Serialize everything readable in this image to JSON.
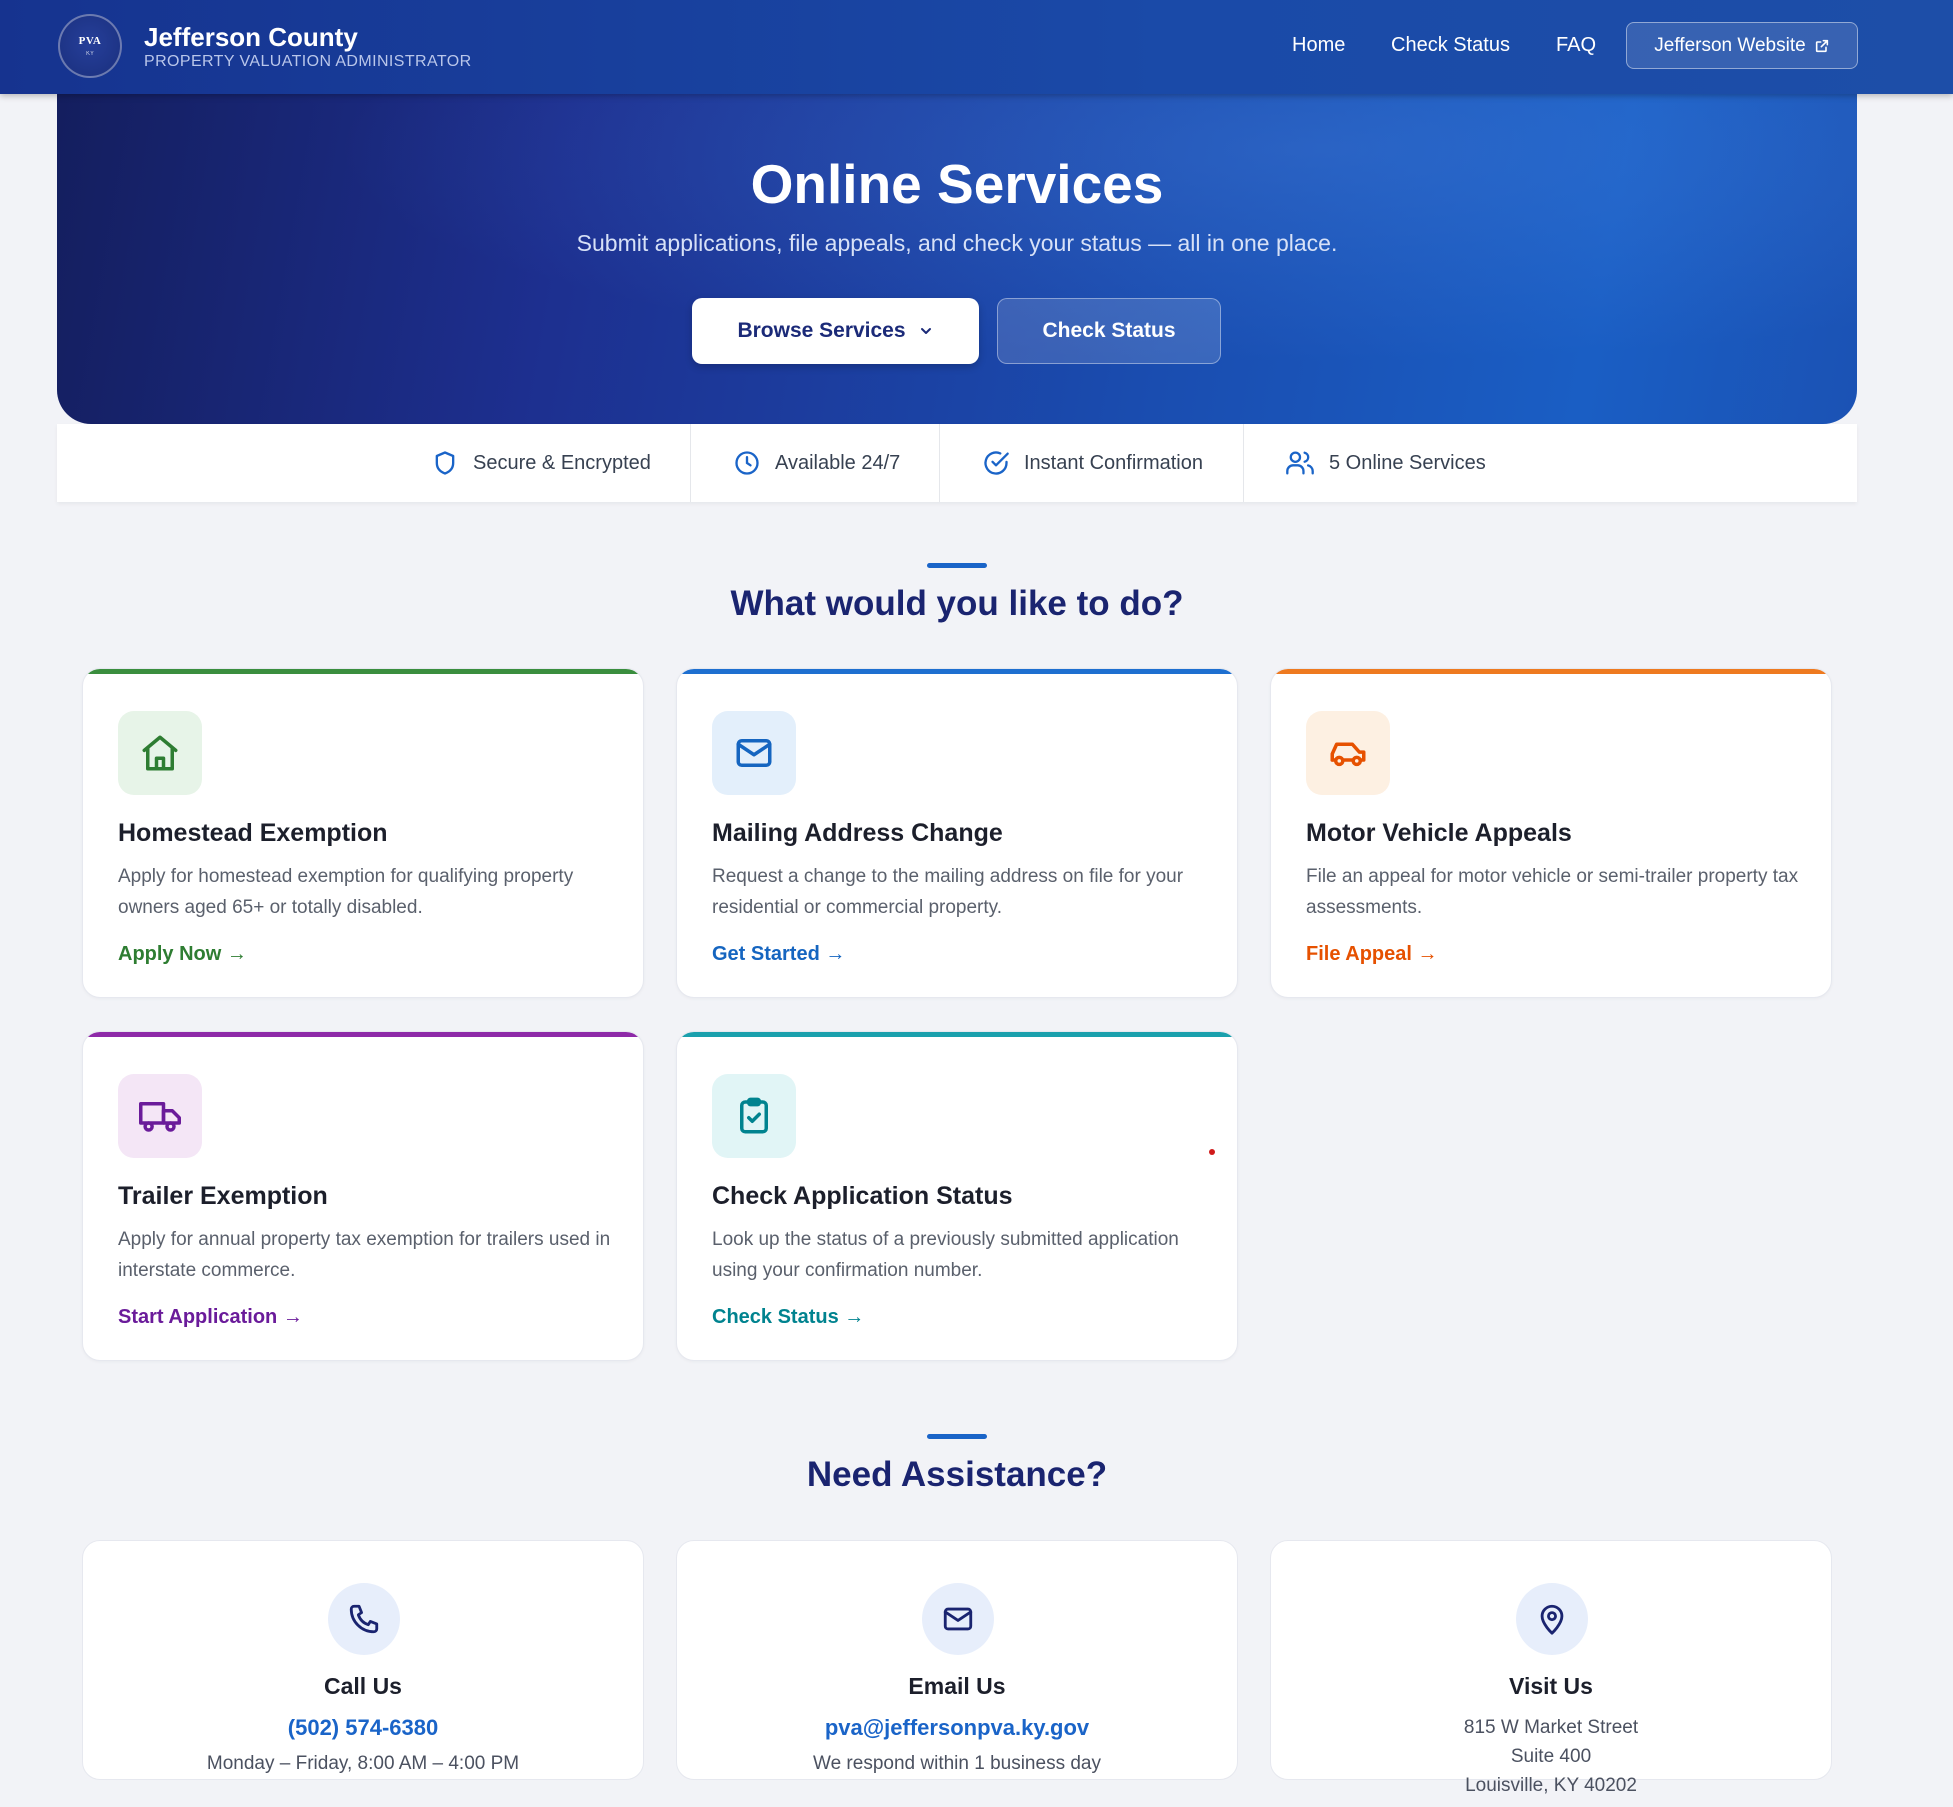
{
  "header": {
    "logo_text": "PVA",
    "logo_sub": "KY",
    "title": "Jefferson County",
    "subtitle": "PROPERTY VALUATION ADMINISTRATOR",
    "nav": [
      "Home",
      "Check Status",
      "FAQ"
    ],
    "website_button": "Jefferson Website"
  },
  "hero": {
    "title": "Online Services",
    "subtitle": "Submit applications, file appeals, and check your status — all in one place.",
    "browse_button": "Browse Services",
    "status_button": "Check Status"
  },
  "features": [
    "Secure & Encrypted",
    "Available 24/7",
    "Instant Confirmation",
    "5 Online Services"
  ],
  "services": {
    "heading": "What would you like to do?",
    "cards": [
      {
        "title": "Homestead Exemption",
        "desc": "Apply for homestead exemption for qualifying property owners aged 65+ or totally disabled.",
        "link": "Apply Now →",
        "color": "#2e7d32",
        "bar": "#3a8e3e",
        "bg": "#e7f4e8",
        "icon": "home-icon"
      },
      {
        "title": "Mailing Address Change",
        "desc": "Request a change to the mailing address on file for your residential or commercial property.",
        "link": "Get Started →",
        "color": "#1565c0",
        "bar": "#1e6fd0",
        "bg": "#e3effb",
        "icon": "mail-icon"
      },
      {
        "title": "Motor Vehicle Appeals",
        "desc": "File an appeal for motor vehicle or semi-trailer property tax assessments.",
        "link": "File Appeal →",
        "color": "#e65100",
        "bar": "#ee7a20",
        "bg": "#fdf0e2",
        "icon": "car-icon"
      },
      {
        "title": "Trailer Exemption",
        "desc": "Apply for annual property tax exemption for trailers used in interstate commerce.",
        "link": "Start Application →",
        "color": "#6a1b9a",
        "bar": "#8e2aa8",
        "bg": "#f4e6f6",
        "icon": "truck-icon"
      },
      {
        "title": "Check Application Status",
        "desc": "Look up the status of a previously submitted application using your confirmation number.",
        "link": "Check Status →",
        "color": "#00838f",
        "bar": "#1aa0ad",
        "bg": "#e1f5f6",
        "icon": "clipboard-check-icon"
      }
    ]
  },
  "assistance": {
    "heading": "Need Assistance?",
    "call": {
      "title": "Call Us",
      "main": "(502) 574-6380",
      "note": "Monday – Friday, 8:00 AM – 4:00 PM"
    },
    "email": {
      "title": "Email Us",
      "main": "pva@jeffersonpva.ky.gov",
      "note": "We respond within 1 business day"
    },
    "visit": {
      "title": "Visit Us",
      "lines": [
        "815 W Market Street",
        "Suite 400",
        "Louisville, KY 40202"
      ]
    }
  }
}
